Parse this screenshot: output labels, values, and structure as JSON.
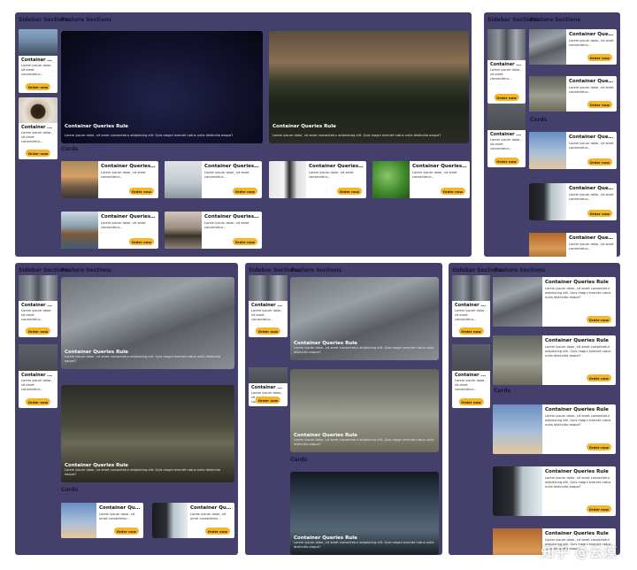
{
  "labels": {
    "sidebar": "Sidebar Sections",
    "feature": "Feature Sections",
    "cards": "Cards"
  },
  "card_title_short": "Container ...",
  "card_title_mid": "Container Queri...",
  "card_title_long": "Container Queries Ru...",
  "card_title_full": "Container Queries Rule",
  "card_desc_short": "Lorem ipsum dolor, sit amet consectetur...",
  "card_desc_full": "Lorem ipsum dolor, sit amet consectetur adipisicing elit. Quis magni eveniet natus nulla distinctio eaque?",
  "feature_title": "Container Queries Rule",
  "feature_desc": "Lorem ipsum dolor, sit amet consectetur adipisicing elit. Quis magni eveniet natus nulla distinctio eaque?",
  "button": "Order now",
  "watermark": "知乎 @云漠",
  "colors": {
    "panel": "#453f6c",
    "button": "#f5b729",
    "card": "#ffffff"
  }
}
